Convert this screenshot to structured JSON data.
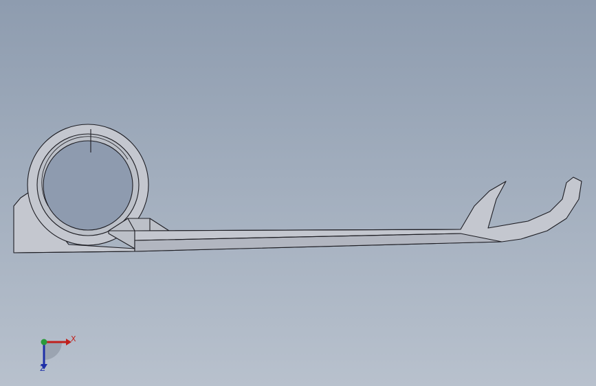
{
  "viewport": {
    "background_top": "#8e9caf",
    "background_bottom": "#b8c1cd"
  },
  "part": {
    "fill_color": "#c4c7cf",
    "shade_color": "#a7abb6",
    "edge_color": "#1c1c22"
  },
  "triad": {
    "x_label": "X",
    "z_label": "Z",
    "x_color": "#c0201c",
    "y_color": "#2a9a3a",
    "z_color": "#1e2fa8"
  }
}
